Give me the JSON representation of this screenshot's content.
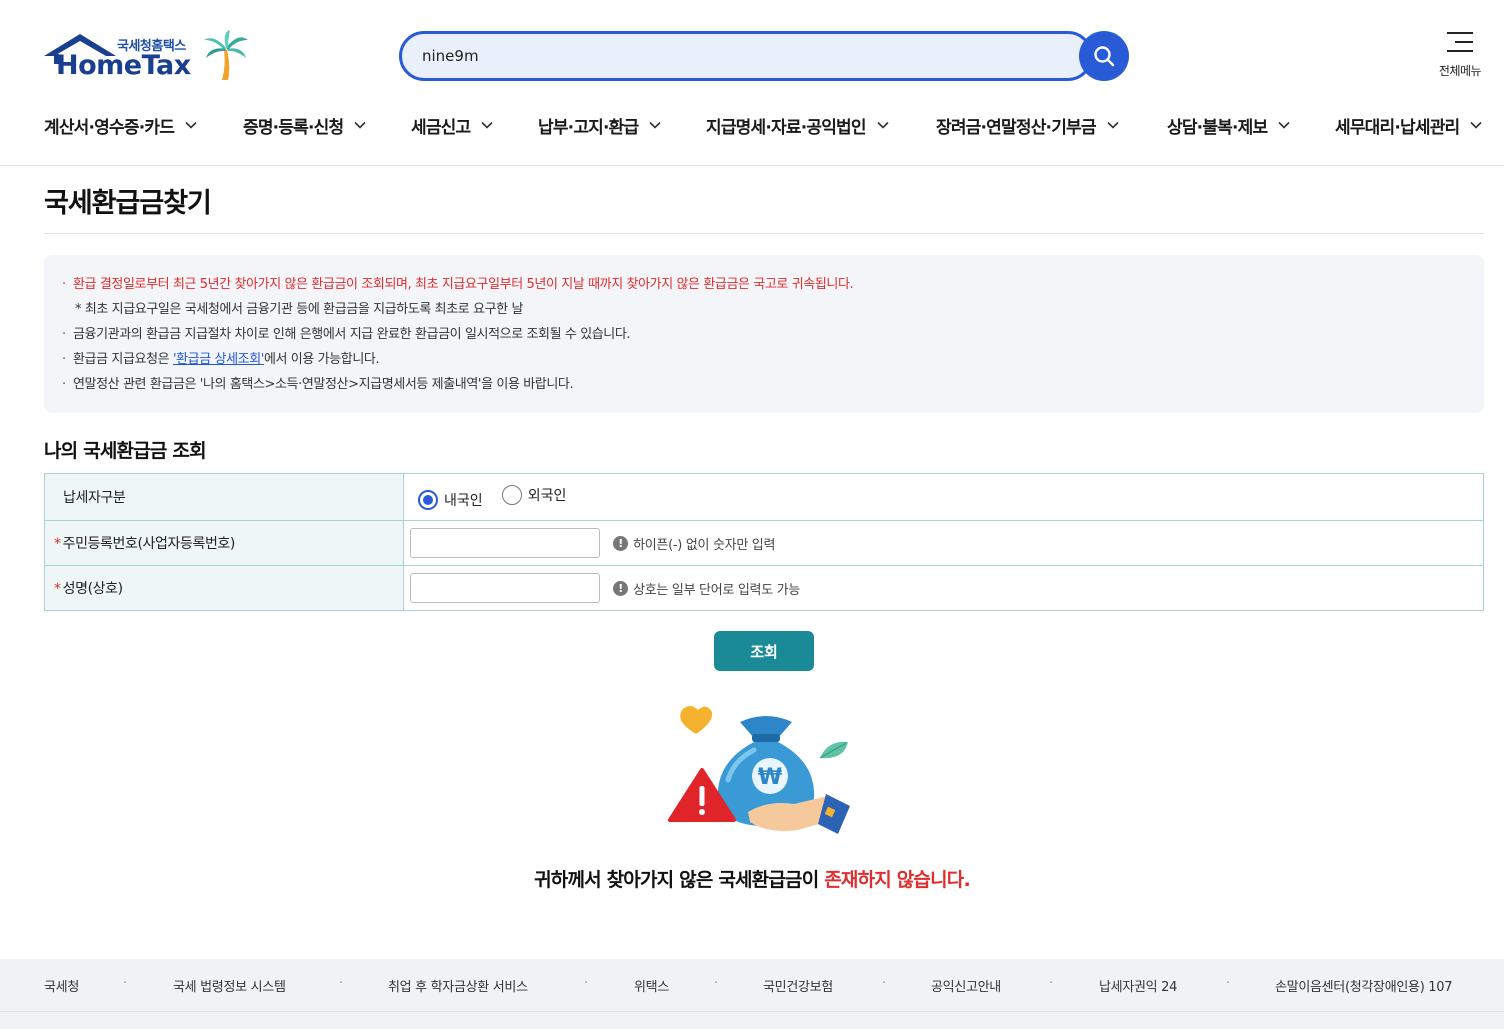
{
  "header": {
    "logo_sub": "국세청홈택스",
    "logo_main": "HomeTax",
    "search_value": "nine9m",
    "all_menu_label": "전체메뉴"
  },
  "gnb": [
    {
      "label": "계산서·영수증·카드"
    },
    {
      "label": "증명·등록·신청"
    },
    {
      "label": "세금신고"
    },
    {
      "label": "납부·고지·환급"
    },
    {
      "label": "지급명세·자료·공익법인"
    },
    {
      "label": "장려금·연말정산·기부금"
    },
    {
      "label": "상담·불복·제보"
    },
    {
      "label": "세무대리·납세관리"
    }
  ],
  "page": {
    "title": "국세환급금찾기"
  },
  "notice": {
    "line1": "환급 결정일로부터 최근 5년간 찾아가지 않은 환급금이 조회되며, 최초 지급요구일부터 5년이 지날 때까지 찾아가지 않은 환급금은 국고로 귀속됩니다.",
    "line2": "* 최초 지급요구일은 국세청에서 금융기관 등에 환급금을 지급하도록 최초로 요구한 날",
    "line3": "금융기관과의 환급금 지급절차 차이로 인해 은행에서 지급 완료한 환급금이 일시적으로 조회될 수 있습니다.",
    "line4_pre": "환급금 지급요청은 ",
    "line4_link": "'환급금 상세조회'",
    "line4_post": "에서 이용 가능합니다.",
    "line5": "연말정산 관련 환급금은 '나의 홈택스>소득·연말정산>지급명세서등 제출내역'을 이용 바랍니다."
  },
  "form": {
    "section_title": "나의 국세환급금 조회",
    "taxpayer_type_label": "납세자구분",
    "radio_domestic": "내국인",
    "radio_foreign": "외국인",
    "selected": "내국인",
    "id_label": "주민등록번호(사업자등록번호)",
    "id_value": "",
    "id_hint": "하이픈(-) 없이 숫자만 입력",
    "name_label": "성명(상호)",
    "name_value": "",
    "name_hint": "상호는 일부 단어로 입력도 가능",
    "required_mark": "*",
    "query_button": "조회"
  },
  "result": {
    "msg_pre": "귀하께서 찾아가지 않은 국세환급금이 ",
    "msg_red": "존재하지 않습니다."
  },
  "footer": {
    "links": [
      "국세청",
      "국세 법령정보 시스템",
      "취업 후 학자금상환 서비스",
      "위택스",
      "국민건강보험",
      "공익신고안내",
      "납세자권익 24",
      "손말이음센터(청각장애인용) 107"
    ],
    "separator": "·"
  },
  "colors": {
    "brand_blue": "#2a5bd7",
    "logo_blue": "#1b3f8f",
    "teal_button": "#1a8a96",
    "alert_red": "#e02d2d",
    "link_blue": "#1f57d6"
  }
}
